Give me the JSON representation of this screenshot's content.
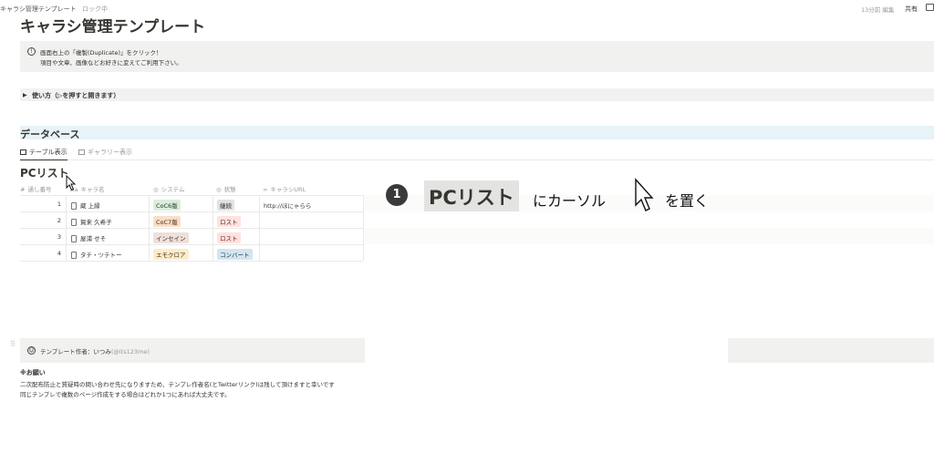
{
  "topbar": {
    "breadcrumb": "キャラシ管理テンプレート",
    "lock": "ロック中",
    "edited": "13分前 編集",
    "share": "共有"
  },
  "page": {
    "title": "キャラシ管理テンプレート"
  },
  "callout": {
    "line1": "画面右上の「複製(Duplicate)」をクリック！",
    "line2": "項目や文章、画像などお好きに変えてご利用下さい。"
  },
  "toggle": {
    "label": "使い方（▷を押すと開きます）"
  },
  "database": {
    "heading": "データベース",
    "views": [
      {
        "label": "テーブル表示"
      },
      {
        "label": "ギャラリー表示"
      }
    ],
    "list_title": "PCリスト",
    "columns": [
      {
        "label": "通し番号",
        "glyph": "#"
      },
      {
        "label": "キャラ名",
        "glyph": "Aa"
      },
      {
        "label": "システム",
        "glyph": "◎"
      },
      {
        "label": "状態",
        "glyph": "◎"
      },
      {
        "label": "キャラシURL",
        "glyph": "∞"
      }
    ],
    "rows": [
      {
        "num": "1",
        "name": "蔵 上縁",
        "system": "CoC6版",
        "status": "継続",
        "url": "http://ほにゃらら"
      },
      {
        "num": "2",
        "name": "賀来 久希子",
        "system": "CoC7版",
        "status": "ロスト",
        "url": ""
      },
      {
        "num": "3",
        "name": "屋浦 せそ",
        "system": "インセイン",
        "status": "ロスト",
        "url": ""
      },
      {
        "num": "4",
        "name": "タチ・ツテトー",
        "system": "エモクロア",
        "status": "コンバート",
        "url": ""
      }
    ]
  },
  "overlay": {
    "step": "1",
    "highlight": "PCリスト",
    "text1": "にカーソル",
    "text2": "を置く"
  },
  "author_callout": {
    "label": "テンプレート作者：いつみ",
    "handle": "(@its123me)"
  },
  "notes": {
    "title": "※お願い",
    "line1": "二次配布防止と質疑時の問い合わせ先になりますため、テンプレ作者名(とTwitterリンク)は残して頂けますと幸いです",
    "line2": "同じテンプレで複数のページ作成をする場合はどれか1つにあれば大丈夫です。"
  },
  "colors": {
    "callout_bg": "#f1f1ef",
    "heading_bg": "#e7f3f8",
    "tag_green": "#dbeddb",
    "tag_orange": "#fadec9",
    "tag_brown": "#eee0da",
    "tag_red": "#ffe2dd",
    "tag_yellow": "#fdecc8",
    "tag_blue": "#d3e5ef",
    "tag_gray": "#e3e2e0"
  }
}
